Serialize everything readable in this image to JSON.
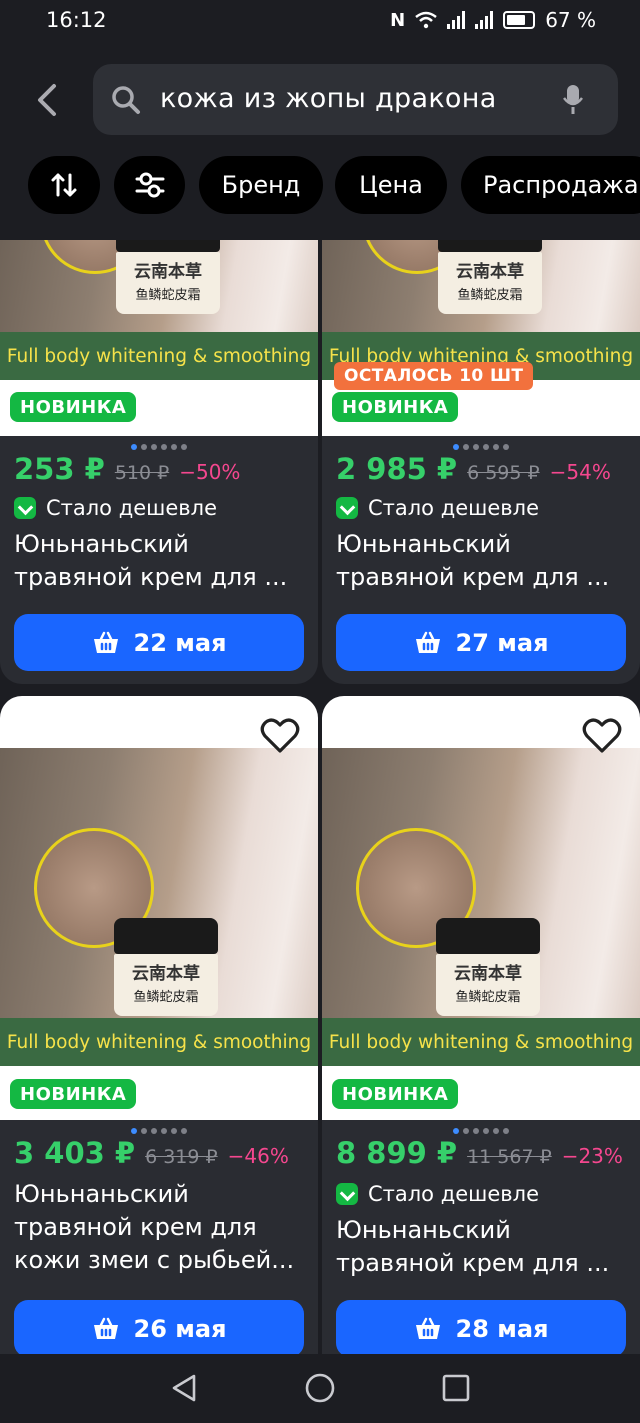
{
  "status_bar": {
    "time": "16:12",
    "battery": "67 %"
  },
  "search": {
    "query": "кожа из жопы дракона"
  },
  "chips": [
    "Бренд",
    "Цена",
    "Распродажа"
  ],
  "image_banner_text": "Full body whitening & smoothing",
  "jar_label": {
    "brand": "云南本草",
    "name": "鱼鳞蛇皮霜"
  },
  "products": [
    {
      "badge_new": "НОВИНКА",
      "price": "253 ₽",
      "old_price": "510 ₽",
      "discount": "−50%",
      "cheaper": "Стало дешевле",
      "title": "Юньнаньский травяной крем для ...",
      "delivery": "22 мая"
    },
    {
      "badge_left": "ОСТАЛОСЬ 10 ШТ",
      "badge_new": "НОВИНКА",
      "price": "2 985 ₽",
      "old_price": "6 595 ₽",
      "discount": "−54%",
      "cheaper": "Стало дешевле",
      "title": "Юньнаньский травяной крем для ...",
      "delivery": "27 мая"
    },
    {
      "badge_new": "НОВИНКА",
      "price": "3 403 ₽",
      "old_price": "6 319 ₽",
      "discount": "−46%",
      "title": "Юньнаньский травяной крем для кожи змеи с рыбьей...",
      "delivery": "26 мая"
    },
    {
      "badge_new": "НОВИНКА",
      "price": "8 899 ₽",
      "old_price": "11 567 ₽",
      "discount": "−23%",
      "cheaper": "Стало дешевле",
      "title": "Юньнаньский травяной крем для ...",
      "delivery": "28 мая"
    }
  ],
  "icons": {
    "back": "chevron-left-icon",
    "search": "search-icon",
    "mic": "mic-icon",
    "sort": "sort-icon",
    "filter": "filter-icon",
    "heart": "heart-icon",
    "cart": "cart-icon"
  },
  "colors": {
    "accent_blue": "#1a66ff",
    "price_green": "#36d06a",
    "discount_pink": "#f5478f",
    "badge_green": "#14b843",
    "badge_orange": "#f2713d"
  }
}
